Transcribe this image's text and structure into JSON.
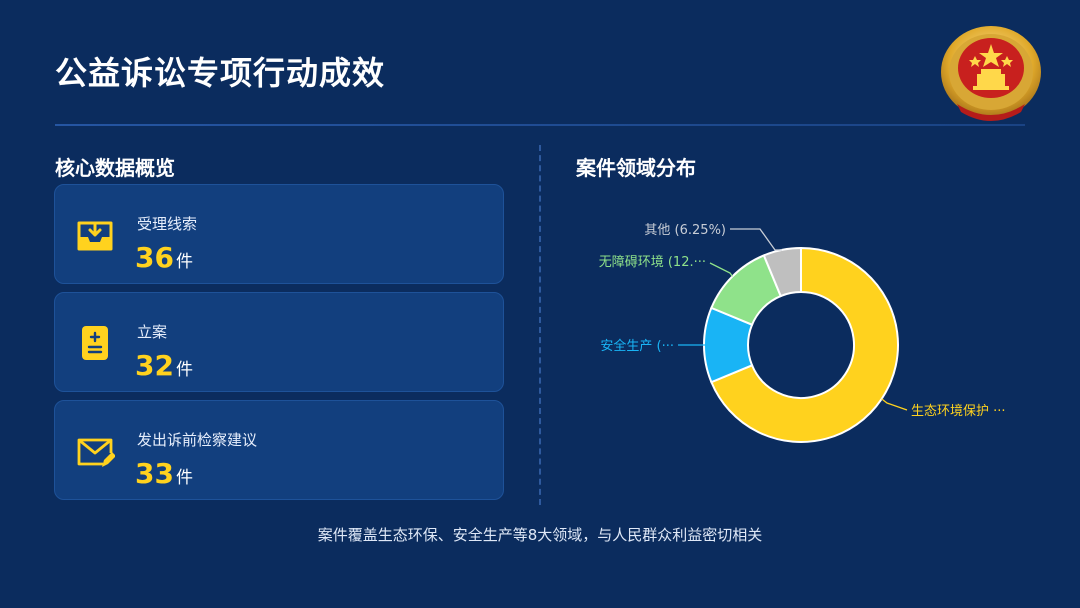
{
  "header": {
    "title": "公益诉讼专项行动成效"
  },
  "overview": {
    "title": "核心数据概览",
    "cards": [
      {
        "label": "受理线索",
        "value": "36",
        "unit": "件",
        "icon": "inbox-download-icon"
      },
      {
        "label": "立案",
        "value": "32",
        "unit": "件",
        "icon": "document-plus-icon"
      },
      {
        "label": "发出诉前检察建议",
        "value": "33",
        "unit": "件",
        "icon": "envelope-edit-icon"
      }
    ]
  },
  "distribution": {
    "title": "案件领域分布"
  },
  "colors": {
    "accent": "#ffd21e",
    "background": "#0b2c5e",
    "card": "#123f7e"
  },
  "chart_data": {
    "type": "pie",
    "variant": "donut",
    "title": "案件领域分布",
    "legend": "none",
    "series": [
      {
        "name": "生态环境保护",
        "label": "生态环境保护 ···",
        "value": 68.75,
        "color": "#ffd21e",
        "label_color": "#ffd21e"
      },
      {
        "name": "安全生产",
        "label": "安全生产 (···",
        "value": 12.5,
        "color": "#19b4f5",
        "label_color": "#19b4f5"
      },
      {
        "name": "无障碍环境",
        "label": "无障碍环境 (12.···",
        "value": 12.5,
        "color": "#8fe28a",
        "label_color": "#8fe28a"
      },
      {
        "name": "其他",
        "label": "其他 (6.25%)",
        "value": 6.25,
        "color": "#bfbfbf",
        "label_color": "#c8cdd6"
      }
    ]
  },
  "footer": {
    "note": "案件覆盖生态环保、安全生产等8大领域，与人民群众利益密切相关"
  }
}
